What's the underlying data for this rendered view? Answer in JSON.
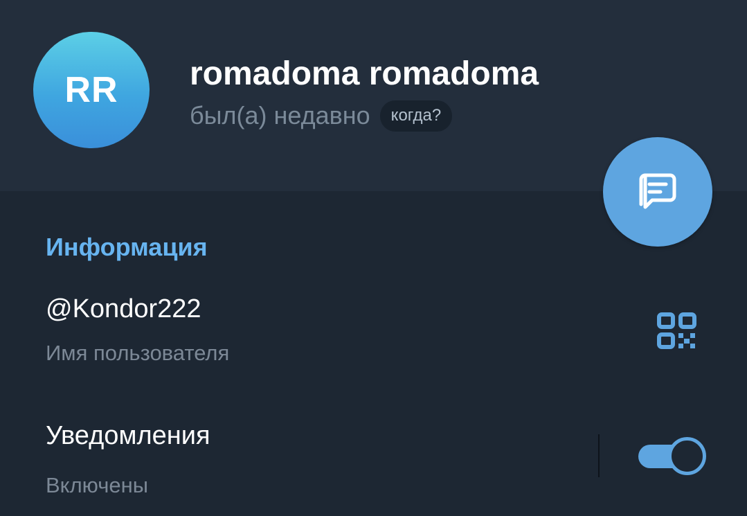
{
  "profile": {
    "initials": "RR",
    "name": "romadoma romadoma",
    "status": "был(а) недавно",
    "when_chip": "когда?"
  },
  "fab": {
    "icon": "message-icon"
  },
  "info": {
    "title": "Информация",
    "username": {
      "value": "@Kondor222",
      "label": "Имя пользователя",
      "icon": "qr-code-icon"
    },
    "notifications": {
      "value": "Уведомления",
      "label": "Включены",
      "enabled": true
    }
  },
  "colors": {
    "background": "#1d2733",
    "header": "#232e3c",
    "accent": "#5ea5e0",
    "section_title": "#67b4f0",
    "secondary_text": "#7c8896"
  }
}
